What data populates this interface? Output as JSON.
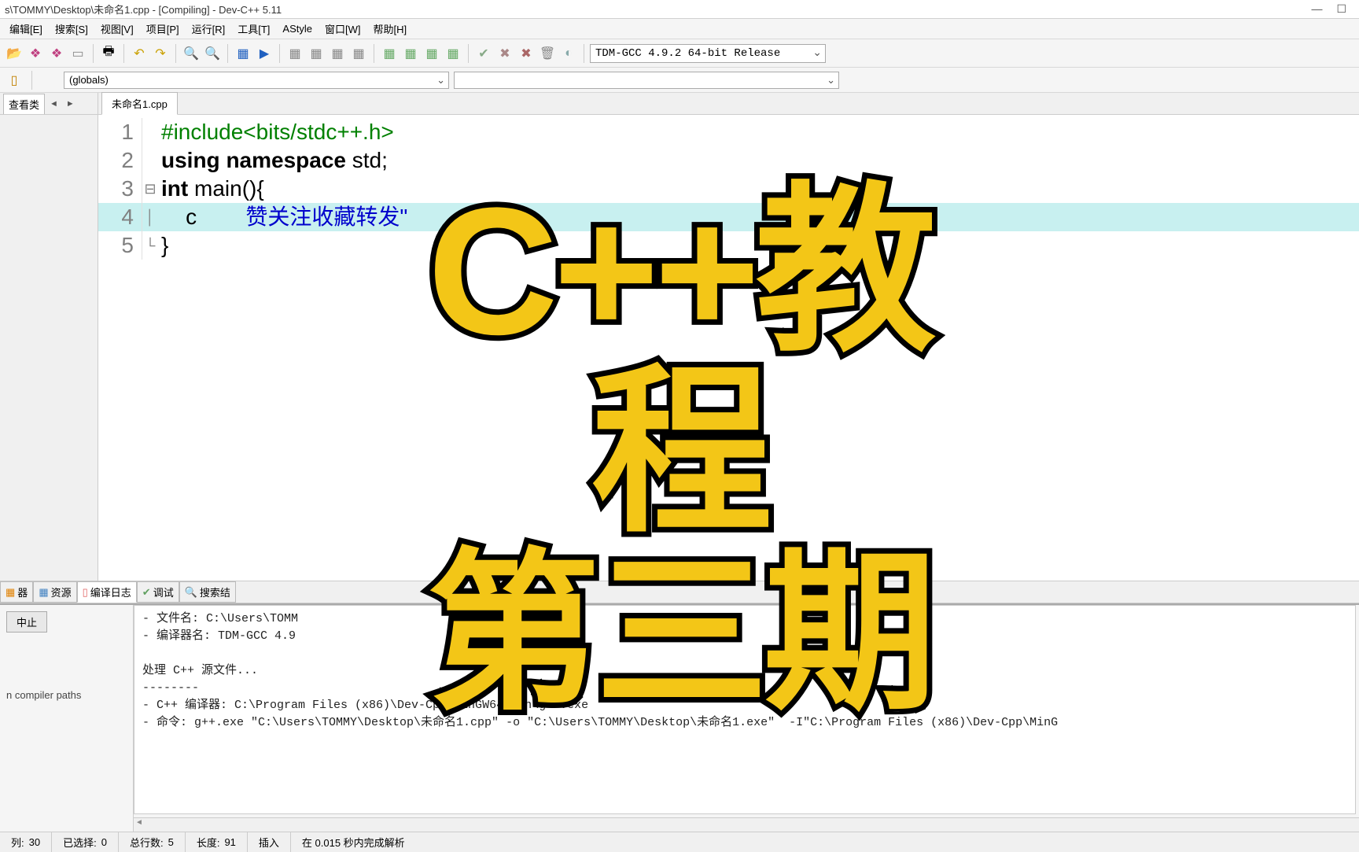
{
  "title": "s\\TOMMY\\Desktop\\未命名1.cpp - [Compiling] - Dev-C++ 5.11",
  "menu": [
    "编辑[E]",
    "搜索[S]",
    "视图[V]",
    "项目[P]",
    "运行[R]",
    "工具[T]",
    "AStyle",
    "窗口[W]",
    "帮助[H]"
  ],
  "compiler_combo": "TDM-GCC 4.9.2 64-bit Release",
  "scope_combo": "(globals)",
  "sidebar_tab": "查看类",
  "editor_tab": "未命名1.cpp",
  "code": {
    "l1": "#include<bits/stdc++.h>",
    "l2a": "using",
    "l2b": "namespace",
    "l2c": " std;",
    "l3a": "int",
    "l3b": " main(){",
    "l4a": "    c",
    "l4b": "赞关注收藏转发\"",
    "l5": "}"
  },
  "bottom_tabs": [
    "器",
    "资源",
    "编译日志",
    "调试",
    "搜索结"
  ],
  "stop_btn": "中止",
  "compiler_paths": "n compiler paths",
  "log_lines": [
    "- 文件名: C:\\Users\\TOMM",
    "- 编译器名: TDM-GCC 4.9",
    "",
    "处理 C++ 源文件...",
    "--------",
    "- C++ 编译器: C:\\Program Files (x86)\\Dev-Cpp\\MinGW64\\bin\\g++.exe",
    "- 命令: g++.exe \"C:\\Users\\TOMMY\\Desktop\\未命名1.cpp\" -o \"C:\\Users\\TOMMY\\Desktop\\未命名1.exe\"  -I\"C:\\Program Files (x86)\\Dev-Cpp\\MinG"
  ],
  "status": {
    "col_label": "列:",
    "col": "30",
    "sel_label": "已选择:",
    "sel": "0",
    "lines_label": "总行数:",
    "lines": "5",
    "len_label": "长度:",
    "len": "91",
    "mode": "插入",
    "parse": "在 0.015 秒内完成解析"
  },
  "overlay": {
    "line1": "C++教程",
    "line2": "第三期"
  }
}
